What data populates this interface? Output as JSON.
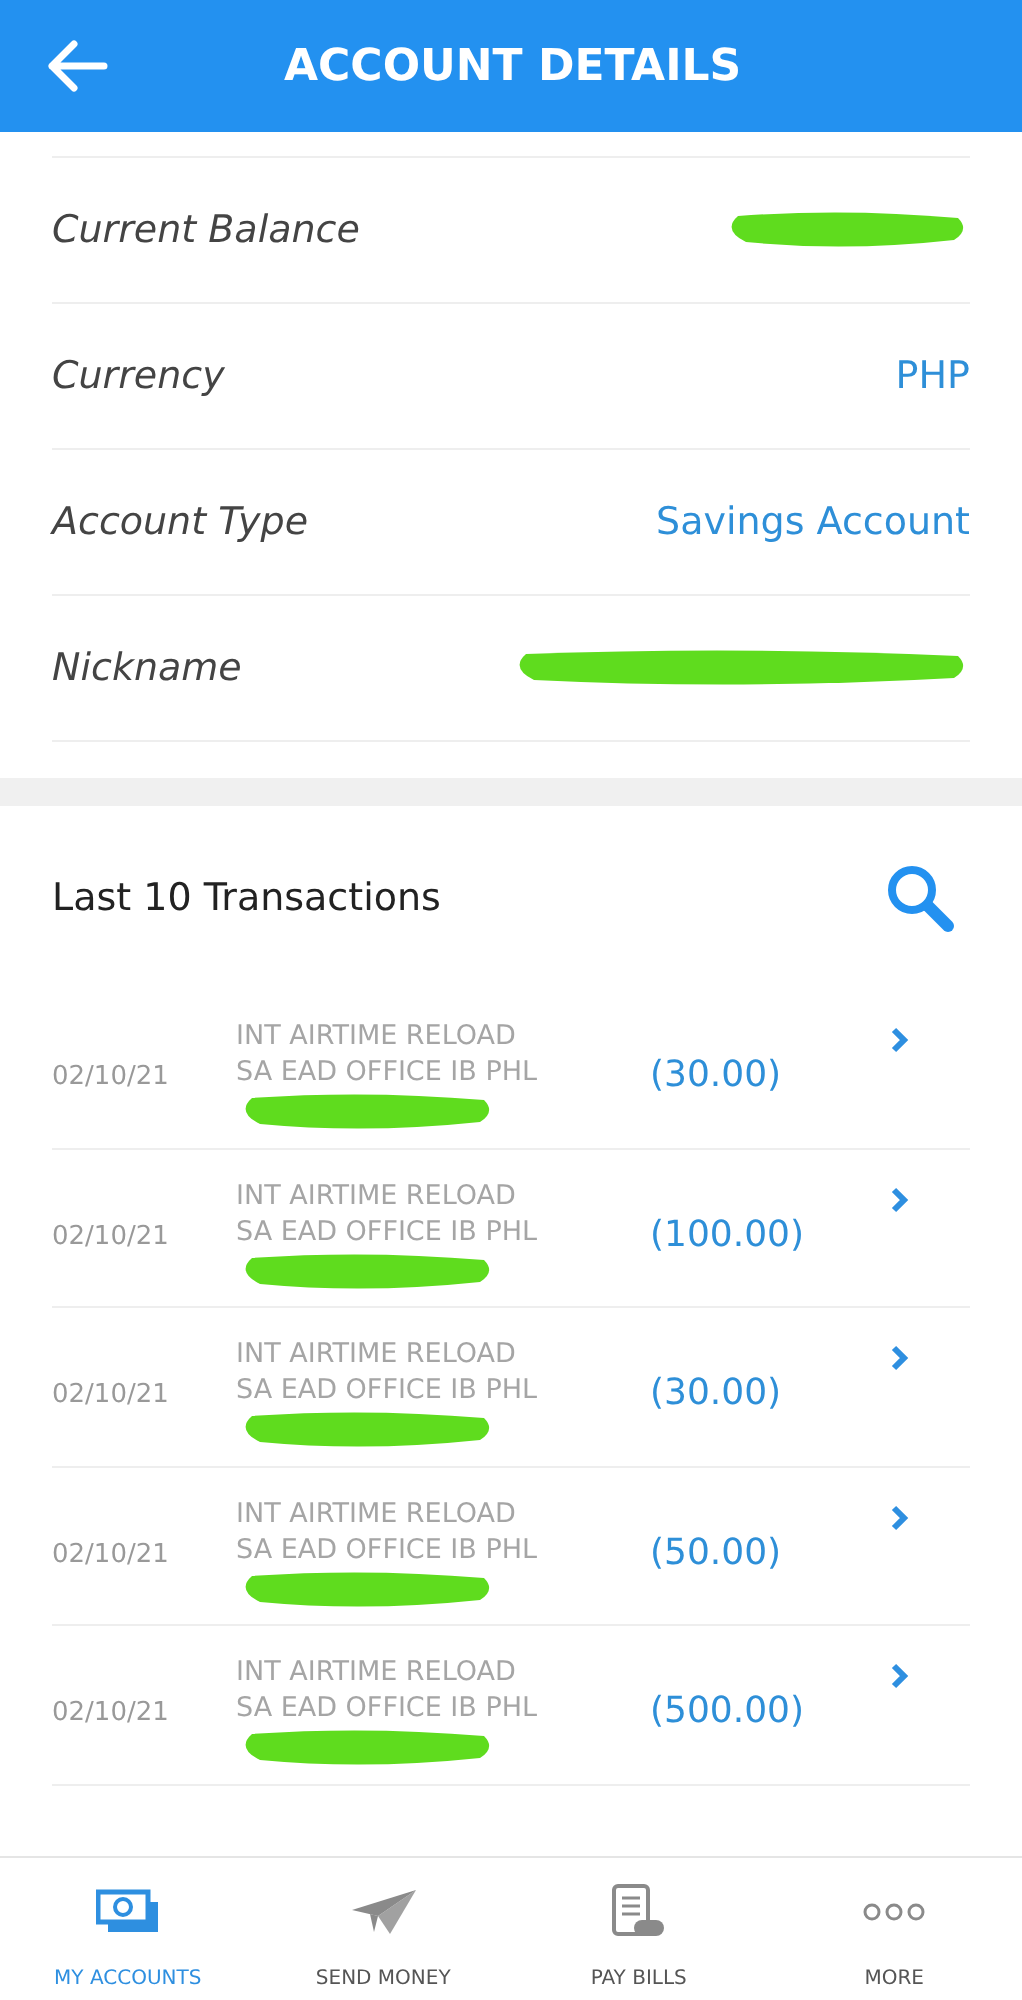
{
  "header": {
    "title": "ACCOUNT DETAILS"
  },
  "details": [
    {
      "label": "Current Balance",
      "redacted": true
    },
    {
      "label": "Currency",
      "value": "PHP",
      "redacted": false
    },
    {
      "label": "Account Type",
      "value": "Savings Account",
      "redacted": false
    },
    {
      "label": "Nickname",
      "redacted": true
    }
  ],
  "transactions": {
    "title": "Last 10 Transactions",
    "rows": [
      {
        "date": "02/10/21",
        "line_1": "INT AIRTIME RELOAD",
        "line_2": "SA EAD OFFICE IB PHL",
        "amount": "(30.00)",
        "redacted": true
      },
      {
        "date": "02/10/21",
        "line_1": "INT AIRTIME RELOAD",
        "line_2": "SA EAD OFFICE IB PHL",
        "amount": "(100.00)",
        "redacted": true
      },
      {
        "date": "02/10/21",
        "line_1": "INT AIRTIME RELOAD",
        "line_2": "SA EAD OFFICE IB PHL",
        "amount": "(30.00)",
        "redacted": true
      },
      {
        "date": "02/10/21",
        "line_1": "INT AIRTIME RELOAD",
        "line_2": "SA EAD OFFICE IB PHL",
        "amount": "(50.00)",
        "redacted": true
      },
      {
        "date": "02/10/21",
        "line_1": "INT AIRTIME RELOAD",
        "line_2": "SA EAD OFFICE IB PHL",
        "amount": "(500.00)",
        "redacted": true
      }
    ]
  },
  "nav": [
    {
      "label": "MY ACCOUNTS",
      "kind": "accounts",
      "selected": true
    },
    {
      "label": "SEND MONEY",
      "kind": "send",
      "selected": false
    },
    {
      "label": "PAY BILLS",
      "kind": "bills",
      "selected": false
    },
    {
      "label": "MORE",
      "kind": "more",
      "selected": false
    }
  ]
}
